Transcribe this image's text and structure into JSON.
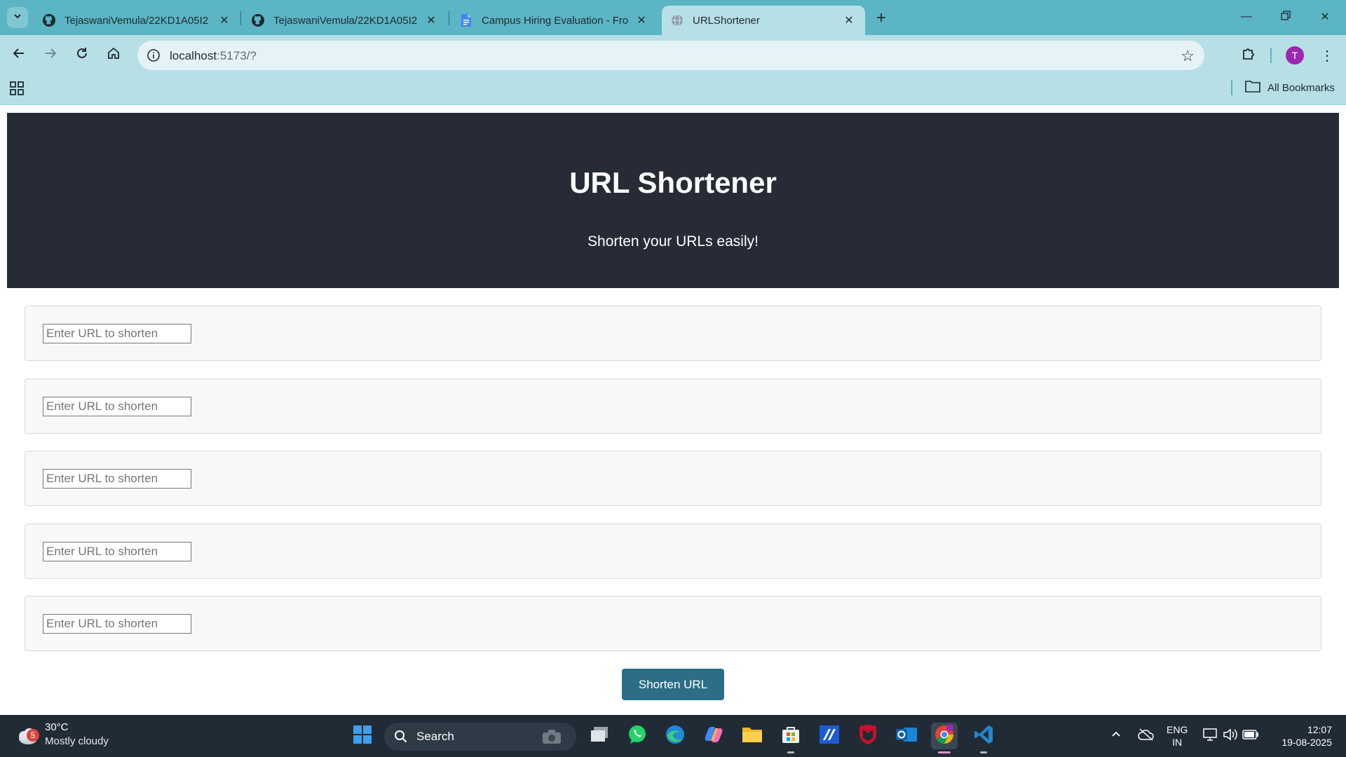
{
  "browser": {
    "tabs": [
      {
        "title": "TejaswaniVemula/22KD1A05I2",
        "icon": "github-icon"
      },
      {
        "title": "TejaswaniVemula/22KD1A05I2",
        "icon": "github-icon"
      },
      {
        "title": "Campus Hiring Evaluation - Fro",
        "icon": "google-docs-icon"
      },
      {
        "title": "URLShortener",
        "icon": "globe-icon",
        "active": true
      }
    ],
    "address": {
      "host": "localhost",
      "path": ":5173/?"
    },
    "bookmarks_label": "All Bookmarks",
    "profile_initial": "T"
  },
  "page": {
    "title": "URL Shortener",
    "subtitle": "Shorten your URLs easily!",
    "url_inputs": [
      {
        "placeholder": "Enter URL to shorten",
        "value": ""
      },
      {
        "placeholder": "Enter URL to shorten",
        "value": ""
      },
      {
        "placeholder": "Enter URL to shorten",
        "value": ""
      },
      {
        "placeholder": "Enter URL to shorten",
        "value": ""
      },
      {
        "placeholder": "Enter URL to shorten",
        "value": ""
      }
    ],
    "submit_label": "Shorten URL",
    "colors": {
      "hero_bg": "#262b35",
      "button_bg": "#2b6e86"
    }
  },
  "taskbar": {
    "weather": {
      "badge": "5",
      "temp": "30°C",
      "condition": "Mostly cloudy"
    },
    "search_label": "Search",
    "lang": {
      "line1": "ENG",
      "line2": "IN"
    },
    "clock": {
      "time": "12:07",
      "date": "19-08-2025"
    }
  }
}
